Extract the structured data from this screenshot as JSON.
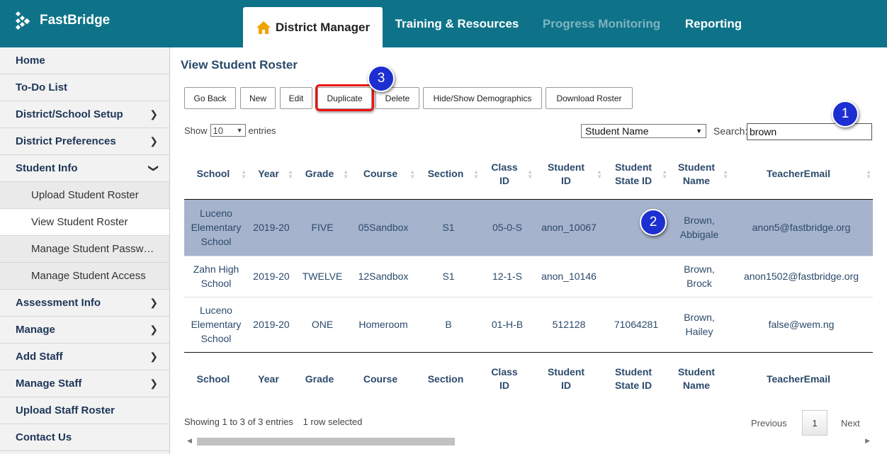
{
  "header": {
    "logo_text": "FastBridge",
    "tabs": [
      {
        "label": "District Manager"
      },
      {
        "label": "Training & Resources"
      },
      {
        "label": "Progress Monitoring"
      },
      {
        "label": "Reporting"
      }
    ]
  },
  "sidebar": {
    "items": [
      {
        "label": "Home"
      },
      {
        "label": "To-Do List"
      },
      {
        "label": "District/School Setup"
      },
      {
        "label": "District Preferences"
      },
      {
        "label": "Student Info"
      },
      {
        "label": "Upload Student Roster"
      },
      {
        "label": "View Student Roster"
      },
      {
        "label": "Manage Student Passw…"
      },
      {
        "label": "Manage Student Access"
      },
      {
        "label": "Assessment Info"
      },
      {
        "label": "Manage"
      },
      {
        "label": "Add Staff"
      },
      {
        "label": "Manage Staff"
      },
      {
        "label": "Upload Staff Roster"
      },
      {
        "label": "Contact Us"
      }
    ]
  },
  "main": {
    "title": "View Student Roster",
    "toolbar": {
      "go_back": "Go Back",
      "new": "New",
      "edit": "Edit",
      "duplicate": "Duplicate",
      "delete": "Delete",
      "hide_show": "Hide/Show Demographics",
      "download": "Download Roster"
    },
    "show_label": "Show",
    "entries_value": "10",
    "entries_label": "entries",
    "column_select": "Student Name",
    "search_label": "Search:",
    "search_value": "brown",
    "columns": [
      "School",
      "Year",
      "Grade",
      "Course",
      "Section",
      "Class ID",
      "Student ID",
      "Student State ID",
      "Student Name",
      "TeacherEmail"
    ],
    "rows": [
      {
        "school": "Luceno Elementary School",
        "year": "2019-20",
        "grade": "FIVE",
        "course": "05Sandbox",
        "section": "S1",
        "class_id": "05-0-S",
        "student_id": "anon_10067",
        "state_id": "",
        "name": "Brown, Abbigale",
        "email": "anon5@fastbridge.org"
      },
      {
        "school": "Zahn High School",
        "year": "2019-20",
        "grade": "TWELVE",
        "course": "12Sandbox",
        "section": "S1",
        "class_id": "12-1-S",
        "student_id": "anon_10146",
        "state_id": "",
        "name": "Brown, Brock",
        "email": "anon1502@fastbridge.org"
      },
      {
        "school": "Luceno Elementary School",
        "year": "2019-20",
        "grade": "ONE",
        "course": "Homeroom",
        "section": "B",
        "class_id": "01-H-B",
        "student_id": "512128",
        "state_id": "71064281",
        "name": "Brown, Hailey",
        "email": "false@wem.ng"
      }
    ],
    "info_text": "Showing 1 to 3 of 3 entries",
    "selected_text": "1 row selected",
    "pagination": {
      "previous": "Previous",
      "page": "1",
      "next": "Next"
    }
  },
  "callouts": {
    "one": "1",
    "two": "2",
    "three": "3"
  },
  "colors": {
    "header_bg": "#0e7389",
    "selected_row": "#a6b3cc",
    "badge": "#1d2fd1",
    "highlight": "#e11111"
  }
}
